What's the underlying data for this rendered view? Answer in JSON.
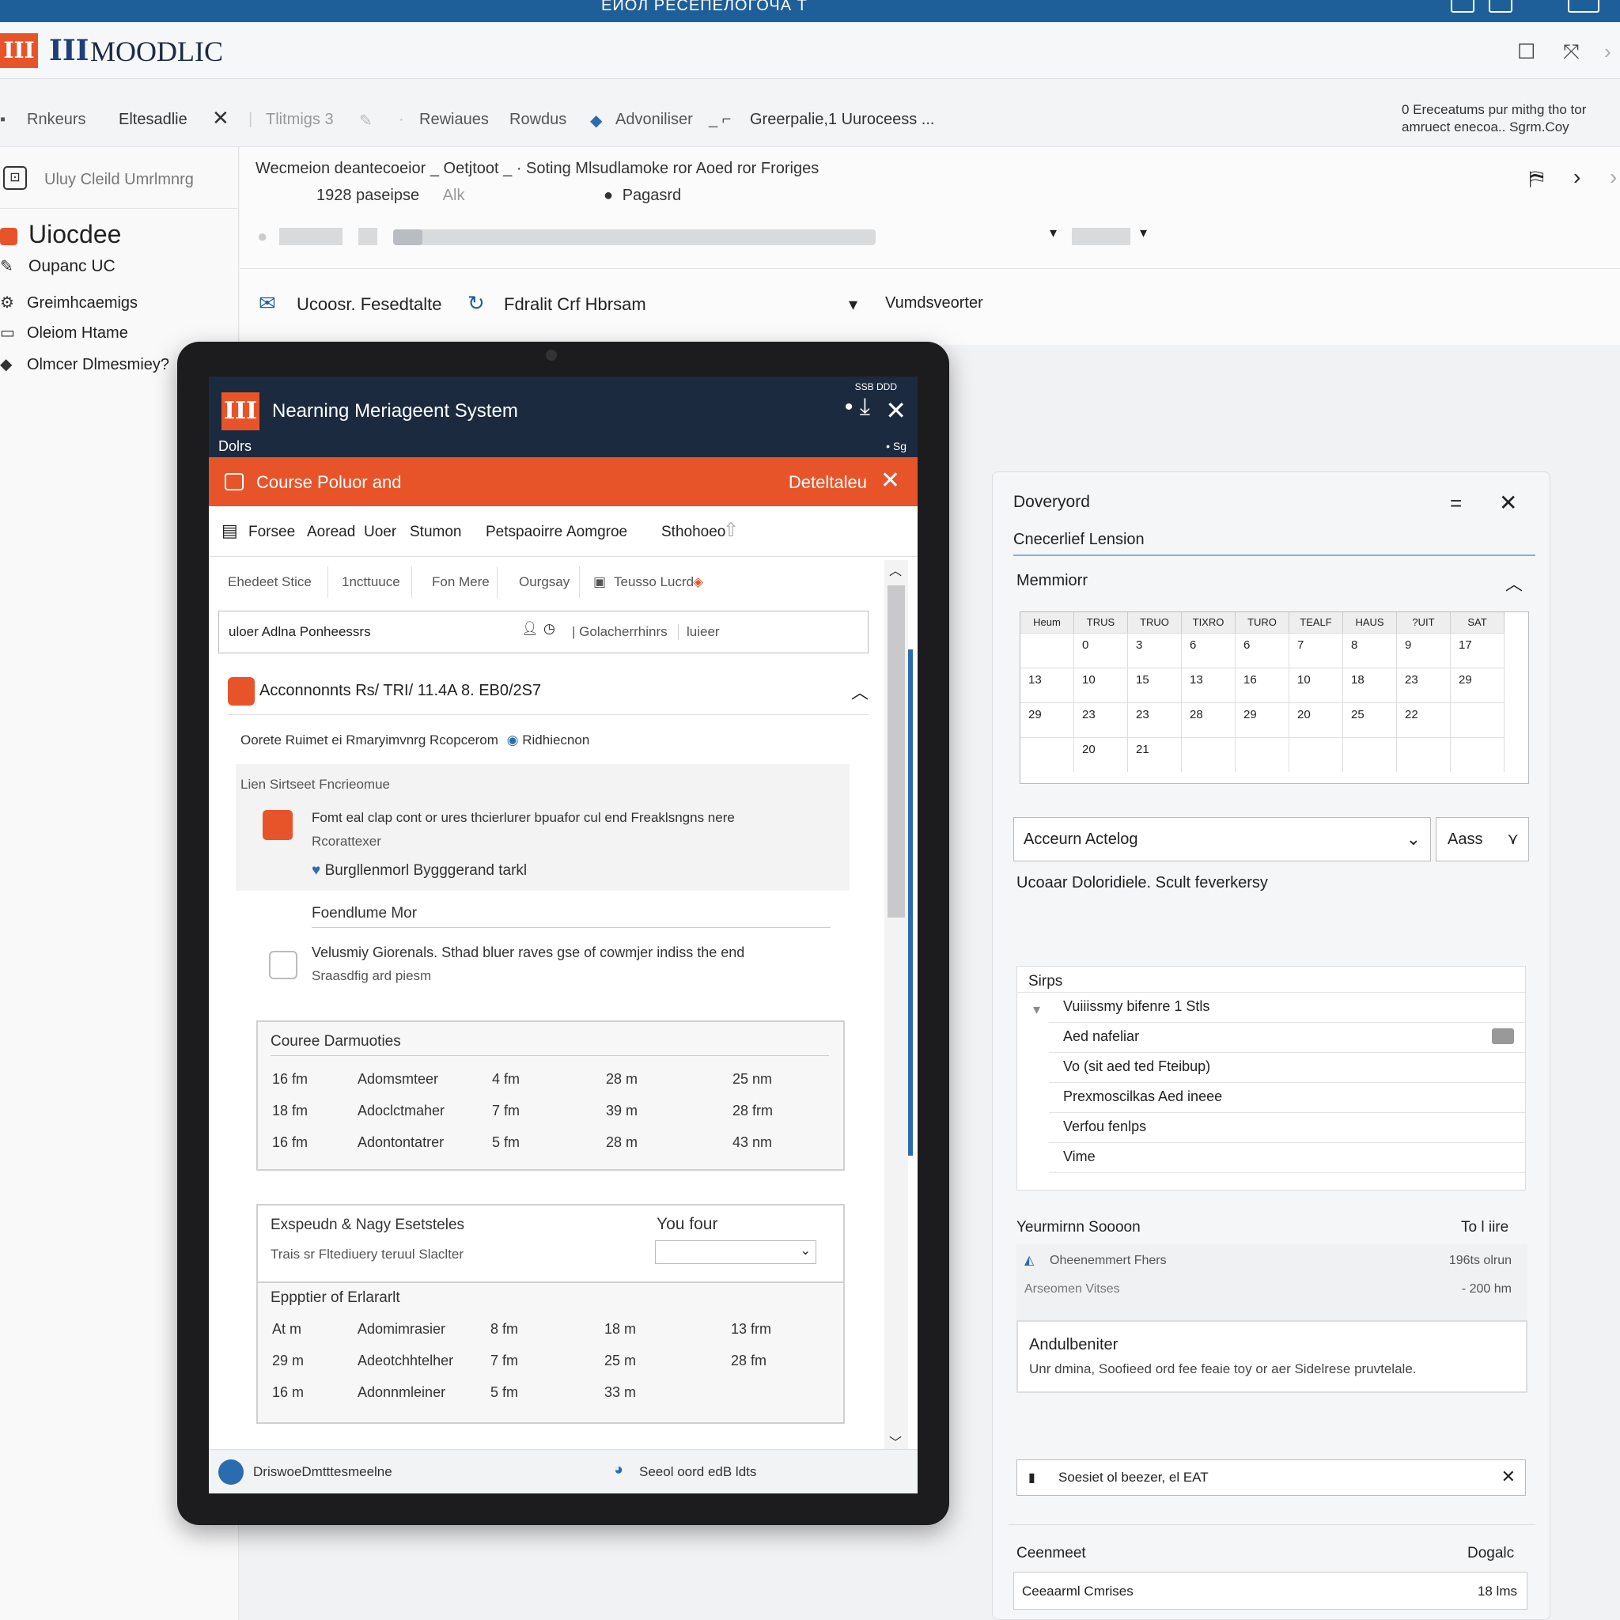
{
  "window": {
    "title": "ЕИОЛ РЕСЕПЕЛОГОЧА Т"
  },
  "brand": {
    "name": "MOODLIC",
    "logo_text": "III",
    "pillar_icon": "III"
  },
  "tabs": [
    "Rnkeurs",
    "Eltesadlie",
    "Tlitmigs 3",
    "Rewiaues",
    "Rowdus",
    "Advoniliser",
    "Greerpalie,1 Uuroceess ..."
  ],
  "tab_note": "0 Ereceatums pur mithg tho tor amruect enecoa.. Sgrm.Coy",
  "left": {
    "search_placeholder": "Uluy Cleild Umrlmnrg",
    "title": "Uiocdee",
    "items": [
      "Oupanc UC",
      "Greimhcaemigs",
      "Oleiom Htame",
      "Olmcer Dlmesmiey?"
    ]
  },
  "main": {
    "line1": "Wecmeion deantecoeior _ Oetjtoot _ · Soting Mlsudlamoke ror Aoed ror Froriges",
    "pages": "1928 paseipse",
    "alk": "Alk",
    "regard": "Pagasrd",
    "sub1": "Ucoosr. Fesedtalte",
    "sub2": "Fdralit Crf Hbrsam",
    "sub3": "Vumdsveorter"
  },
  "app": {
    "title": "Nearning Meriageent System",
    "subtitle": "Dolrs",
    "status_top": "SSB DDD",
    "status_right": "• Sg",
    "orange_title": "Course Poluor and",
    "orange_right": "Deteltaleu",
    "menu": [
      "Forsee",
      "Aoread",
      "Uoer",
      "Stumon",
      "Petspaoirre",
      "Aomgroe",
      "Sthohoeo"
    ],
    "subtabs": [
      "Ehedeet Stice",
      "1ncttuuce",
      "Fon Mere",
      "Ourgsay",
      "Teusso Lucrd"
    ],
    "search_text": "uloer Adlna Ponheessrs",
    "search_mid": "| Golacherrhinrs",
    "search_right": "luieer",
    "card_title": "Acconnonnts Rs/ TRI/ 11.4A 8. EB0/2S7",
    "card_sub": "Oorete Ruimet ei Rmaryimvnrg Rcopcerom",
    "card_sub_link": "Ridhiecnon",
    "sec1_head": "Lien Sirtseet Fncrieomue",
    "sec1_text": "Fomt eal clap cont or ures thcierlurer bpuafor cul end Freaklsngns nere",
    "sec1_text2": "Rcorattexer",
    "sec1_link": "Burgllenmorl Bygggerand tarkl",
    "sec2_head": "Foendlume Mor",
    "sec2_text": "Velusmiy Giorenals. Sthad bluer raves gse of cowmjer indiss the end",
    "sec2_text2": "Sraasdfig ard piesm",
    "durations_title": "Couree Darmuoties",
    "durations": [
      [
        "16 fm",
        "Adomsmteer",
        "4 fm",
        "28 m",
        "25 nm"
      ],
      [
        "18 fm",
        "Adoclctmaher",
        "7 fm",
        "39 m",
        "28 frm"
      ],
      [
        "16 fm",
        "Adontontatrer",
        "5 fm",
        "28 m",
        "43 nm"
      ]
    ],
    "exp_title": "Exspeudn & Nagy Esetsteles",
    "exp_right": "You four",
    "exp_sub": "Trais sr Fltediuery teruul Slaclter",
    "eps_title": "Eppptier of Erlararlt",
    "eps_rows": [
      [
        "At m",
        "Adomimrasier",
        "8 fm",
        "18 m",
        "13 frm"
      ],
      [
        "29 m",
        "Adeotchhtelher",
        "7 fm",
        "25 m",
        "28 fm"
      ],
      [
        "16 m",
        "Adonnmleiner",
        "5 fm",
        "33 m",
        ""
      ]
    ],
    "footer_left": "DriswoeDmtttesmeelne",
    "footer_right": "Seeol oord edB ldts"
  },
  "right": {
    "title": "Doveryord",
    "subtitle": "Cnecerlief Lension",
    "calendar_title": "Memmiorr",
    "cal_head": [
      "Heum",
      "TRUS",
      "TRUO",
      "TIXRO",
      "TURO",
      "TEALF",
      "HAUS",
      "?UIT",
      "SAT"
    ],
    "cal_rows": [
      [
        "",
        "0",
        "3",
        "6",
        "6",
        "7",
        "8",
        "9",
        "17"
      ],
      [
        "13",
        "10",
        "15",
        "13",
        "16",
        "10",
        "18",
        "23",
        "29"
      ],
      [
        "29",
        "23",
        "23",
        "28",
        "29",
        "20",
        "25",
        "22",
        ""
      ],
      [
        "",
        "20",
        "21",
        "",
        "",
        "",
        "",
        "",
        ""
      ]
    ],
    "select_label": "Acceurn Actelog",
    "select_btn": "Aass",
    "desc": "Ucoaar Doloridiele. Scult feverkersy",
    "list_head": "Sirps",
    "list_items": [
      "Vuiiissmy bifenre 1 Stls",
      "Aed nafeliar",
      "Vo (sit aed ted Fteibup)",
      "Prexmoscilkas Aed ineee",
      "Verfou fenlps",
      "Vime"
    ],
    "section2_title": "Yeurmirnn Soooon",
    "section2_right": "To l iire",
    "s2_row1": "Oheenemmert Fhers",
    "s2_row1r": "196ts olrun",
    "s2_row2": "Arseomen Vitses",
    "s2_row2r": "- 200 hm",
    "ad_title": "Andulbeniter",
    "ad_text": "Unr dmina, Soofieed ord fee feaie toy or aer Sidelrese pruvtelale.",
    "search_bar": "Soesiet ol beezer, el EAT",
    "bottom_left": "Ceenmeet",
    "bottom_right": "Dogalc",
    "last_left": "Ceeaarml Cmrises",
    "last_right": "18 lms"
  },
  "colors": {
    "accent": "#e8542a",
    "navy": "#1b2a3e",
    "blue": "#1f5f99"
  }
}
